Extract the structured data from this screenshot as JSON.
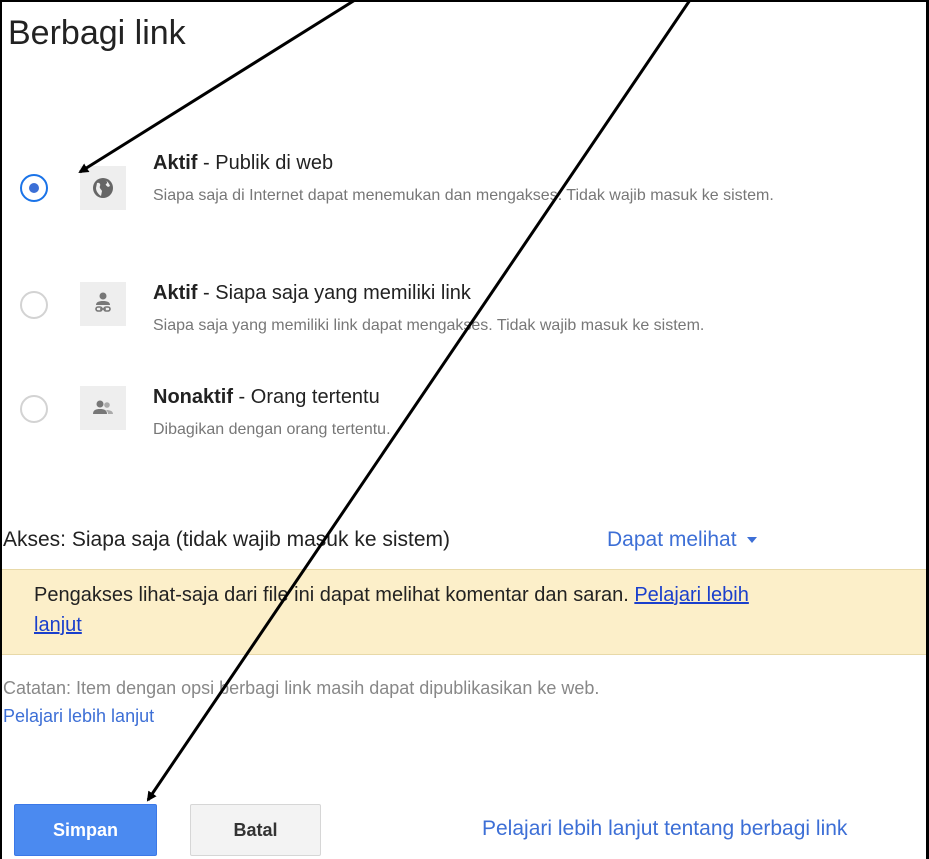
{
  "dialog": {
    "title": "Berbagi link"
  },
  "options": [
    {
      "state": "Aktif",
      "title_rest": " - Publik di web",
      "description": "Siapa saja di Internet dapat menemukan dan mengakses. Tidak wajib masuk ke sistem.",
      "icon": "globe-icon",
      "selected": true
    },
    {
      "state": "Aktif",
      "title_rest": " - Siapa saja yang memiliki link",
      "description": "Siapa saja yang memiliki link dapat mengakses. Tidak wajib masuk ke sistem.",
      "icon": "person-link-icon",
      "selected": false
    },
    {
      "state": "Nonaktif",
      "title_rest": " - Orang tertentu",
      "description": "Dibagikan dengan orang tertentu.",
      "icon": "people-icon",
      "selected": false
    }
  ],
  "access": {
    "label": "Akses:  Siapa saja (tidak wajib masuk ke sistem)",
    "permission": "Dapat melihat"
  },
  "notice": {
    "text": "Pengakses lihat-saja dari file ini dapat melihat komentar dan saran.",
    "link": "Pelajari lebih lanjut"
  },
  "note": {
    "text": "Catatan: Item dengan opsi berbagi link masih dapat dipublikasikan ke web.",
    "link": "Pelajari lebih lanjut"
  },
  "buttons": {
    "save": "Simpan",
    "cancel": "Batal"
  },
  "footer": {
    "learn_more": "Pelajari lebih lanjut tentang berbagi link"
  },
  "colors": {
    "accent": "#4b8af0",
    "link": "#3d6fd6",
    "notice_bg": "#fcefc9"
  }
}
